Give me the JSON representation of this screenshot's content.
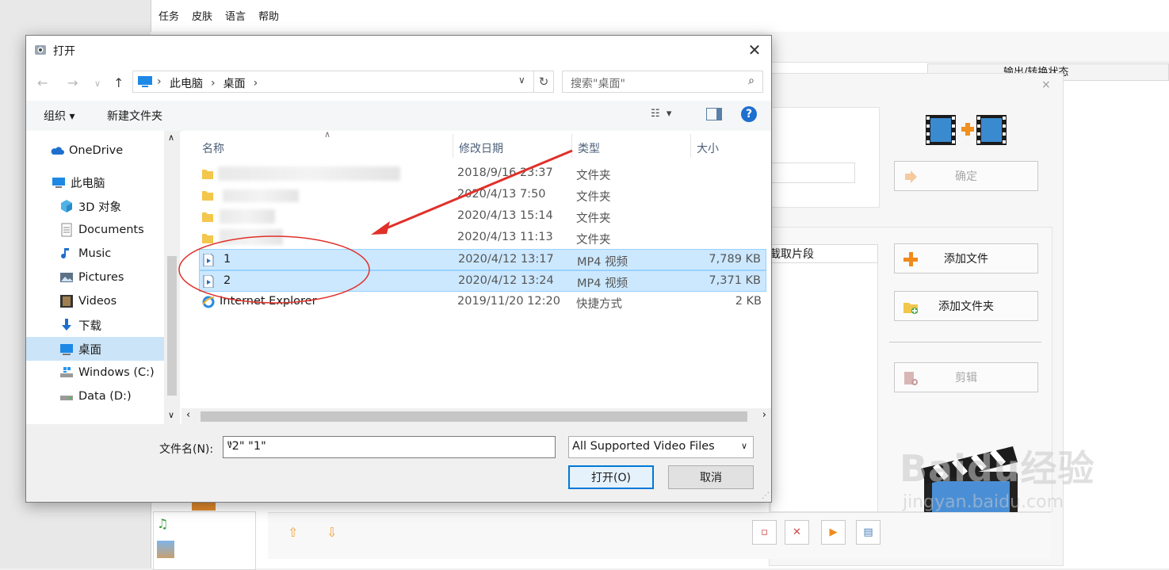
{
  "background_app": {
    "menu": [
      "任务",
      "皮肤",
      "语言",
      "帮助"
    ],
    "status_header": "输出/转换状态",
    "ok_label": "确定",
    "add_file_label": "添加文件",
    "add_folder_label": "添加文件夹",
    "edit_label": "剪辑",
    "clip_header": "截取片段"
  },
  "dialog": {
    "title": "打开",
    "breadcrumb": [
      "此电脑",
      "桌面"
    ],
    "search_placeholder": "搜索\"桌面\"",
    "toolbar": {
      "organize": "组织 ▾",
      "new_folder": "新建文件夹"
    },
    "nav_items": [
      {
        "label": "OneDrive",
        "icon": "cloud-icon"
      },
      {
        "label": "此电脑",
        "icon": "computer-icon"
      },
      {
        "label": "3D 对象",
        "icon": "cube-icon"
      },
      {
        "label": "Documents",
        "icon": "document-icon"
      },
      {
        "label": "Music",
        "icon": "music-icon"
      },
      {
        "label": "Pictures",
        "icon": "picture-icon"
      },
      {
        "label": "Videos",
        "icon": "video-icon"
      },
      {
        "label": "下载",
        "icon": "download-icon"
      },
      {
        "label": "桌面",
        "icon": "desktop-icon"
      },
      {
        "label": "Windows (C:)",
        "icon": "drive-icon"
      },
      {
        "label": "Data (D:)",
        "icon": "drive-icon"
      }
    ],
    "columns": {
      "name": "名称",
      "date": "修改日期",
      "type": "类型",
      "size": "大小"
    },
    "files": [
      {
        "name": "",
        "date": "2018/9/16 23:37",
        "type": "文件夹",
        "size": ""
      },
      {
        "name": "",
        "date": "2020/4/13 7:50",
        "type": "文件夹",
        "size": ""
      },
      {
        "name": "",
        "date": "2020/4/13 15:14",
        "type": "文件夹",
        "size": ""
      },
      {
        "name": "",
        "date": "2020/4/13 11:13",
        "type": "文件夹",
        "size": ""
      },
      {
        "name": "1",
        "date": "2020/4/12 13:17",
        "type": "MP4 视频",
        "size": "7,789 KB"
      },
      {
        "name": "2",
        "date": "2020/4/12 13:24",
        "type": "MP4 视频",
        "size": "7,371 KB"
      },
      {
        "name": "Internet Explorer",
        "date": "2019/11/20 12:20",
        "type": "快捷方式",
        "size": "2 KB"
      }
    ],
    "filename_label": "文件名(N):",
    "filename_value": "\"2\" \"1\"",
    "filetype_value": "All Supported Video Files",
    "open_label": "打开(O)",
    "cancel_label": "取消"
  },
  "watermark": {
    "brand": "Baidu经验",
    "url": "jingyan.baidu.com"
  },
  "colors": {
    "selection": "#cce8ff",
    "annotation": "#e0302a",
    "accent": "#0078d7"
  }
}
